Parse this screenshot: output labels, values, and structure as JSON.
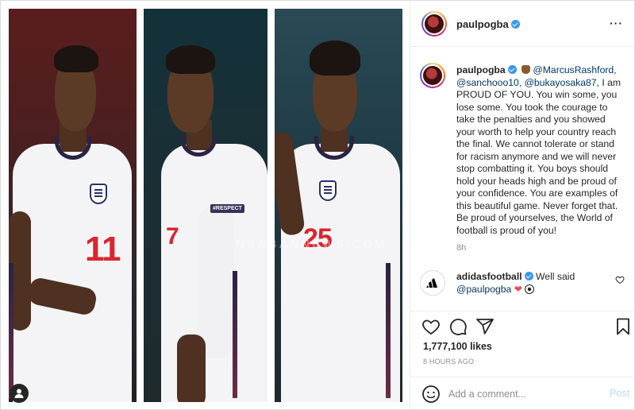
{
  "post": {
    "author": "paulpogba",
    "caption": {
      "username": "paulpogba",
      "mentions": [
        "@MarcusRashford,",
        "@sanchooo10,",
        "@bukayosaka87,"
      ],
      "text": "I am PROUD OF YOU. You win some, you lose some. You took the courage to take the penalties and you showed your worth to help your country reach the final. We cannot tolerate or stand for racism anymore and we will never stop combatting it. You boys should hold your heads high and be proud of your confidence. You are examples of this beautiful game. Never forget that. Be proud of yourselves, the World of football is proud of you!"
    },
    "time_ago": "8h",
    "comment": {
      "username": "adidasfootball",
      "text": "Well said",
      "mention": "@paulpogba"
    },
    "likes": "1,777,100 likes",
    "posted": "8 HOURS AGO",
    "add_comment_placeholder": "Add a comment...",
    "post_label": "Post"
  },
  "media": {
    "players": [
      {
        "number": "11",
        "patch": ""
      },
      {
        "number": "7",
        "patch": "#RESPECT"
      },
      {
        "number": "25",
        "patch": ""
      }
    ],
    "watermark": "NSABANNEWS.COM"
  },
  "colors": {
    "verified": "#3897f0",
    "mention": "#00376b",
    "post_button": "#b2dffc",
    "heart": "#ed4956"
  },
  "icons": [
    "verified-badge-icon",
    "more-options-icon",
    "heart-icon",
    "comment-icon",
    "share-icon",
    "bookmark-icon",
    "emoji-icon",
    "user-tag-icon",
    "adidas-logo-icon"
  ]
}
